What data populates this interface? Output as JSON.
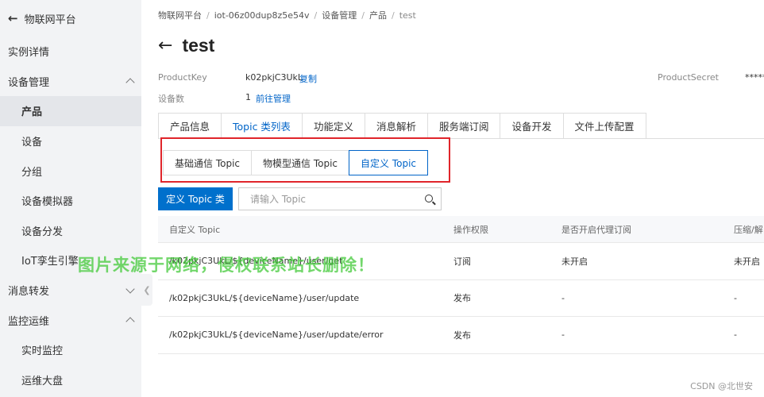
{
  "sidebar": {
    "header": "物联网平台",
    "items": [
      {
        "label": "实例详情"
      },
      {
        "label": "设备管理"
      },
      {
        "label": "产品"
      },
      {
        "label": "设备"
      },
      {
        "label": "分组"
      },
      {
        "label": "设备模拟器"
      },
      {
        "label": "设备分发"
      },
      {
        "label": "IoT孪生引擎"
      },
      {
        "label": "消息转发"
      },
      {
        "label": "监控运维"
      },
      {
        "label": "实时监控"
      },
      {
        "label": "运维大盘"
      }
    ]
  },
  "breadcrumb": [
    "物联网平台",
    "iot-06z00dup8z5e54v",
    "设备管理",
    "产品",
    "test"
  ],
  "page": {
    "title": "test",
    "product_key_label": "ProductKey",
    "product_key_value": "k02pkjC3UkL",
    "copy_label": "复制",
    "device_count_label": "设备数",
    "device_count_value": "1",
    "manage_link": "前往管理",
    "product_secret_label": "ProductSecret",
    "product_secret_value": "*****"
  },
  "tabs": [
    "产品信息",
    "Topic 类列表",
    "功能定义",
    "消息解析",
    "服务端订阅",
    "设备开发",
    "文件上传配置"
  ],
  "subtabs": [
    "基础通信 Topic",
    "物模型通信 Topic",
    "自定义 Topic"
  ],
  "toolbar": {
    "define_button": "定义 Topic 类",
    "search_placeholder": "请输入 Topic"
  },
  "table": {
    "headers": [
      "自定义 Topic",
      "操作权限",
      "是否开启代理订阅",
      "压缩/解"
    ],
    "rows": [
      [
        "/k02pkjC3UkL/${deviceName}/user/get",
        "订阅",
        "未开启",
        "未开启"
      ],
      [
        "/k02pkjC3UkL/${deviceName}/user/update",
        "发布",
        "-",
        "-"
      ],
      [
        "/k02pkjC3UkL/${deviceName}/user/update/error",
        "发布",
        "-",
        "-"
      ]
    ]
  },
  "watermark": "图片来源于网络，侵权联系站长删除！",
  "csdn_credit": "CSDN @北世安",
  "colors": {
    "accent": "#0064c8",
    "highlight_border": "#e0252b",
    "watermark": "#3cc832"
  }
}
